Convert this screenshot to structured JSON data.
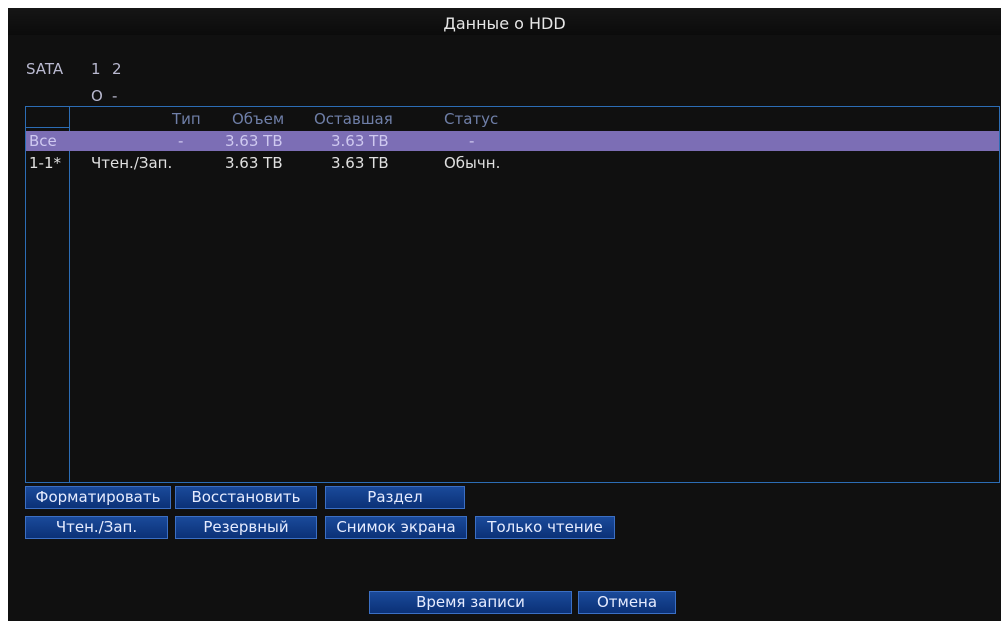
{
  "dialog": {
    "title": "Данные о HDD"
  },
  "sata": {
    "label": "SATA",
    "ports": [
      "1",
      "2"
    ],
    "states": [
      "O",
      "-"
    ]
  },
  "table": {
    "columns": [
      "Тип",
      "Объем",
      "Оставшая",
      "Статус"
    ],
    "rows": [
      {
        "index": "Все",
        "type": "-",
        "capacity": "3.63 TB",
        "remaining": "3.63 TB",
        "status": "-",
        "selected": true
      },
      {
        "index": "1-1*",
        "type": "Чтен./Зап.",
        "capacity": "3.63 TB",
        "remaining": "3.63 TB",
        "status": "Обычн.",
        "selected": false
      }
    ]
  },
  "buttons": {
    "format": "Форматировать",
    "restore": "Восстановить",
    "partition": "Раздел",
    "read_write": "Чтен./Зап.",
    "backup": "Резервный",
    "snapshot": "Снимок экрана",
    "read_only": "Только чтение",
    "record_time": "Время записи",
    "cancel": "Отмена"
  }
}
